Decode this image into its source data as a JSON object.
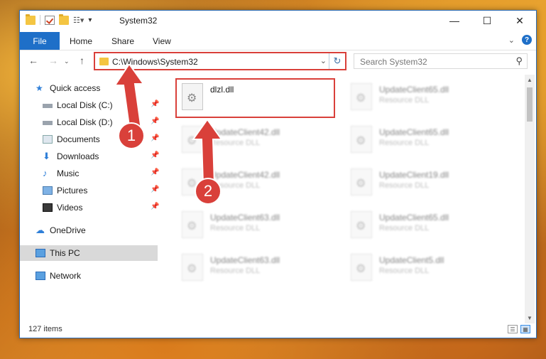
{
  "window": {
    "title": "System32"
  },
  "ribbon": {
    "file": "File",
    "home": "Home",
    "share": "Share",
    "view": "View"
  },
  "address": {
    "path": "C:\\Windows\\System32"
  },
  "search": {
    "placeholder": "Search System32"
  },
  "sidebar": {
    "quick_access": "Quick access",
    "items": [
      {
        "label": "Local Disk (C:)",
        "icon": "drive-icon"
      },
      {
        "label": "Local Disk (D:)",
        "icon": "drive-icon"
      },
      {
        "label": "Documents",
        "icon": "documents-icon"
      },
      {
        "label": "Downloads",
        "icon": "downloads-icon"
      },
      {
        "label": "Music",
        "icon": "music-icon"
      },
      {
        "label": "Pictures",
        "icon": "pictures-icon"
      },
      {
        "label": "Videos",
        "icon": "videos-icon"
      }
    ],
    "onedrive": "OneDrive",
    "thispc": "This PC",
    "network": "Network"
  },
  "files": {
    "selected": {
      "name": "dlzl.dll"
    },
    "blurred": [
      {
        "name": "UpdateClient42.dll",
        "type": "Resource DLL"
      },
      {
        "name": "UpdateClient42.dll",
        "type": "Resource DLL"
      },
      {
        "name": "UpdateClient63.dll",
        "type": "Resource DLL"
      },
      {
        "name": "UpdateClient63.dll",
        "type": "Resource DLL"
      },
      {
        "name": "UpdateClient65.dll",
        "type": "Resource DLL"
      },
      {
        "name": "UpdateClient65.dll",
        "type": "Resource DLL"
      },
      {
        "name": "UpdateClient19.dll",
        "type": "Resource DLL"
      },
      {
        "name": "UpdateClient65.dll",
        "type": "Resource DLL"
      },
      {
        "name": "UpdateClient5.dll",
        "type": "Resource DLL"
      }
    ]
  },
  "status": {
    "count": "127 items"
  },
  "annotations": {
    "one": "1",
    "two": "2"
  },
  "colors": {
    "accent": "#1e6fc8",
    "highlight": "#d9403a"
  }
}
